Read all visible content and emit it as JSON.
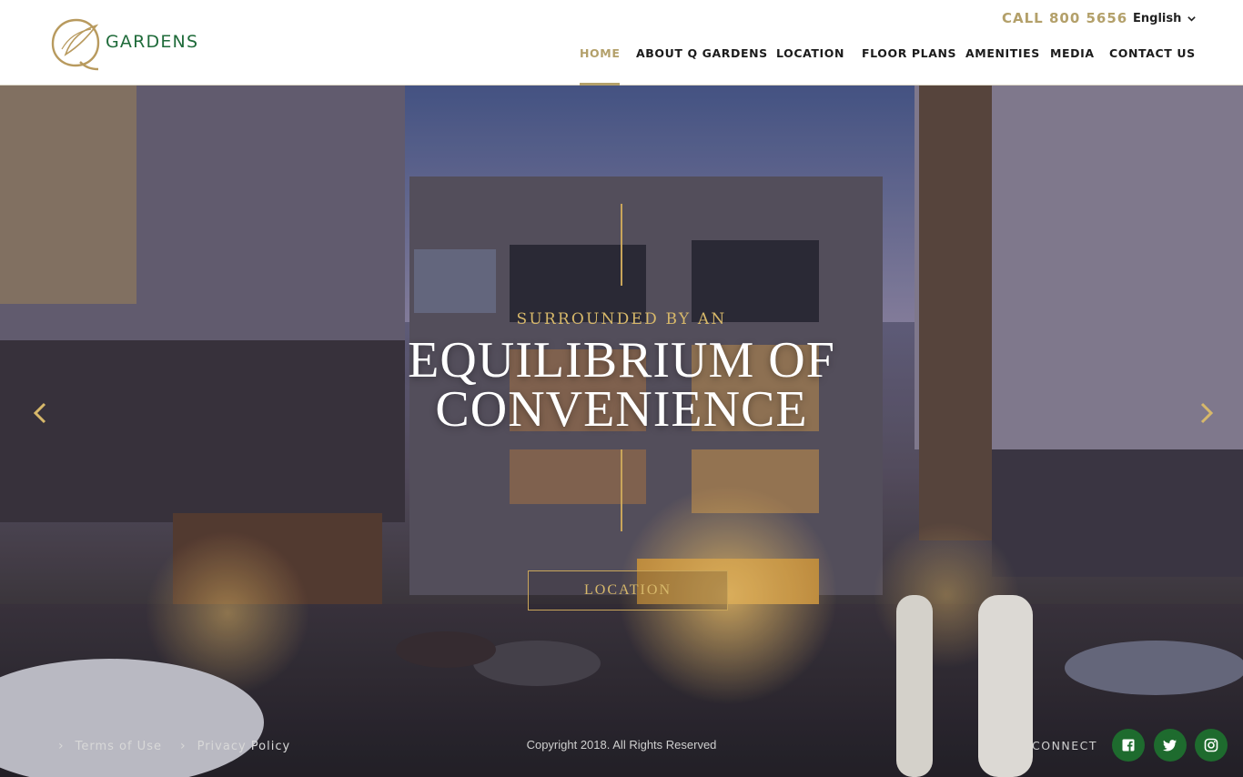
{
  "header": {
    "logo_text": "GARDENS",
    "call": "CALL 800 5656",
    "language": "English",
    "nav": [
      {
        "label": "HOME",
        "active": true
      },
      {
        "label": "ABOUT Q GARDENS",
        "active": false
      },
      {
        "label": "LOCATION",
        "active": false
      },
      {
        "label": "FLOOR PLANS",
        "active": false
      },
      {
        "label": "AMENITIES",
        "active": false
      },
      {
        "label": "MEDIA",
        "active": false
      },
      {
        "label": "CONTACT US",
        "active": false
      }
    ]
  },
  "hero": {
    "subtitle": "SURROUNDED BY AN",
    "title_line1": "EQUILIBRIUM OF",
    "title_line2": "CONVENIENCE",
    "cta": "LOCATION"
  },
  "footer": {
    "links": [
      "Terms of Use",
      "Privacy Policy"
    ],
    "copyright": "Copyright 2018. All Rights Reserved",
    "connect": "CONNECT",
    "social": [
      "facebook-icon",
      "twitter-icon",
      "instagram-icon"
    ]
  },
  "colors": {
    "accent_gold": "#b3a06a",
    "brand_green": "#1f6b3a",
    "social_green": "#1e6b2e"
  }
}
